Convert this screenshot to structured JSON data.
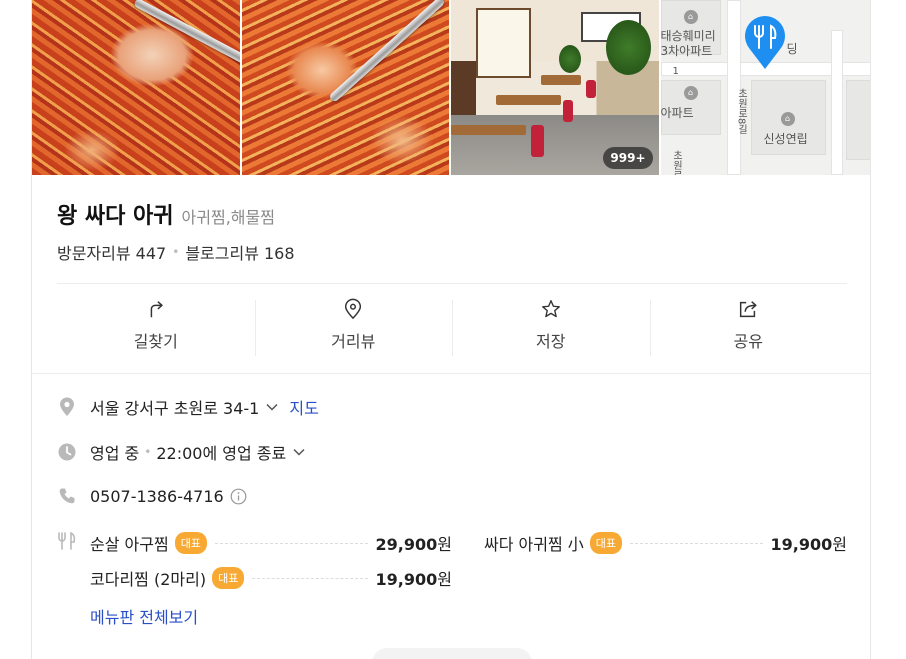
{
  "photos": {
    "count_badge": "999+"
  },
  "map": {
    "labels": [
      "태승훼미리",
      "3차아파트",
      "아파트",
      "신성연립",
      "초원로8길",
      "초원로2길",
      "딩",
      "1"
    ]
  },
  "place": {
    "name": "왕 싸다 아귀",
    "category": "아귀찜,해물찜",
    "visitor_reviews": "방문자리뷰 447",
    "blog_reviews": "블로그리뷰 168"
  },
  "actions": {
    "directions": "길찾기",
    "street_view": "거리뷰",
    "save": "저장",
    "share": "공유"
  },
  "info": {
    "address": "서울 강서구 초원로 34-1",
    "map_link": "지도",
    "status": "영업 중",
    "hours": "22:00에 영업 종료",
    "phone": "0507-1386-4716"
  },
  "menu": {
    "items": [
      {
        "name": "순살 아구찜",
        "tag": "대표",
        "price": "29,900",
        "unit": "원"
      },
      {
        "name": "싸다 아귀찜 小",
        "tag": "대표",
        "price": "19,900",
        "unit": "원"
      },
      {
        "name": "코다리찜 (2마리)",
        "tag": "대표",
        "price": "19,900",
        "unit": "원"
      }
    ],
    "view_all": "메뉴판 전체보기"
  },
  "colors": {
    "accent_blue": "#2a50c8",
    "tag_orange": "#f7a934",
    "pin_blue": "#1e8ff0"
  }
}
